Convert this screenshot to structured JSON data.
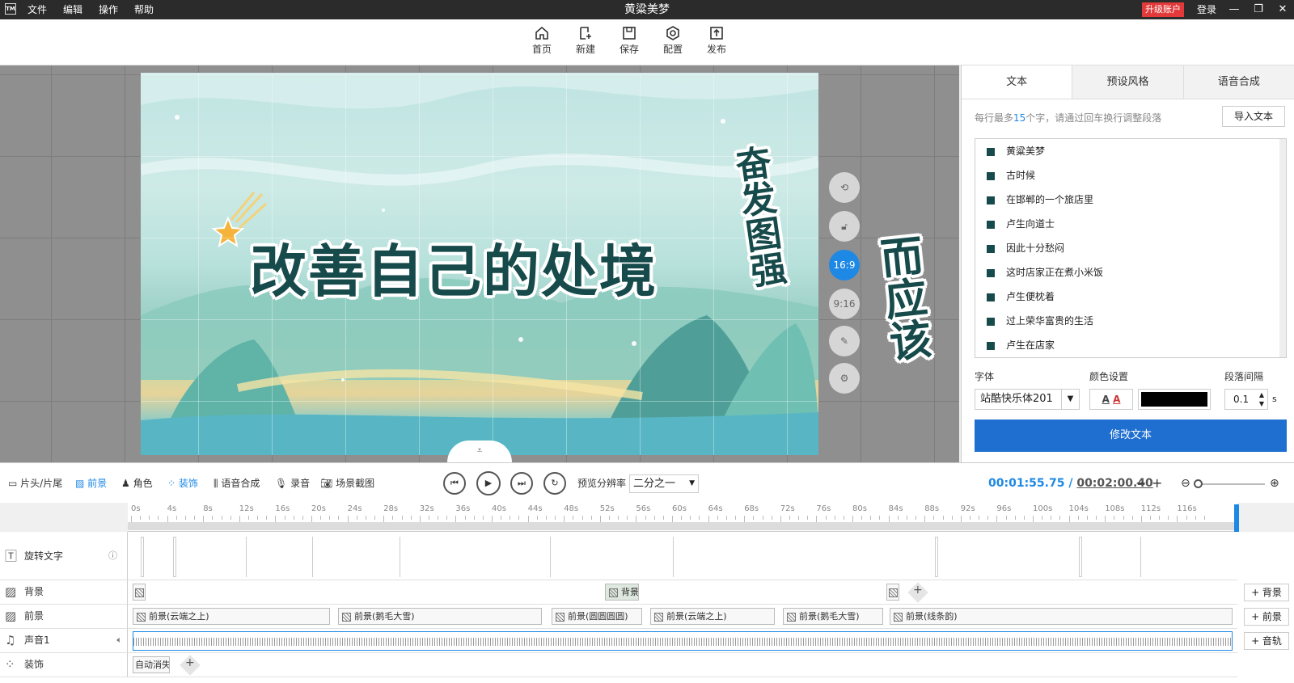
{
  "window": {
    "logo": "TM",
    "menu": [
      "文件",
      "编辑",
      "操作",
      "帮助"
    ],
    "title": "黄粱美梦",
    "upgrade_label": "升级账户",
    "login_label": "登录",
    "controls": [
      "—",
      "❐",
      "✕"
    ]
  },
  "toolbar": {
    "buttons": [
      {
        "label": "首页",
        "icon": "home-icon"
      },
      {
        "label": "新建",
        "icon": "new-icon"
      },
      {
        "label": "保存",
        "icon": "save-icon"
      },
      {
        "label": "配置",
        "icon": "settings-icon"
      },
      {
        "label": "发布",
        "icon": "publish-icon"
      }
    ]
  },
  "stage": {
    "main_text": "改善自己的处境",
    "side_text": "奋发图强",
    "outside_text": "而应该"
  },
  "canvas_controls": {
    "ratio_16_9": "16:9",
    "ratio_9_16": "9:16"
  },
  "panel": {
    "tabs": [
      "文本",
      "预设风格",
      "语音合成"
    ],
    "hint_before": "每行最多",
    "hint_num": "15",
    "hint_after": "个字，请通过回车换行调整段落",
    "import_label": "导入文本",
    "lines": [
      "黄粱美梦",
      "古时候",
      "在邯郸的一个旅店里",
      "卢生向道士",
      "因此十分愁闷",
      "这时店家正在煮小米饭",
      "卢生便枕着",
      "过上荣华富贵的生活",
      "卢生在店家"
    ],
    "font_label": "字体",
    "font_value": "站酷快乐体201",
    "color_label": "颜色设置",
    "spacing_label": "段落间隔",
    "spacing_value": "0.1",
    "spacing_unit": "s",
    "modify_label": "修改文本",
    "text_color": "#000000"
  },
  "timeline_bar": {
    "items": [
      "片头/片尾",
      "前景",
      "角色",
      "装饰",
      "语音合成",
      "录音",
      "场景截图"
    ],
    "preview_label": "预览分辨率",
    "preview_value": "二分之一",
    "current_time": "00:01:55.75",
    "separator": "/",
    "total_time": "00:02:00.40"
  },
  "ruler": {
    "ticks": [
      "0s",
      "4s",
      "8s",
      "12s",
      "16s",
      "20s",
      "24s",
      "28s",
      "32s",
      "36s",
      "40s",
      "44s",
      "48s",
      "52s",
      "56s",
      "60s",
      "64s",
      "68s",
      "72s",
      "76s",
      "80s",
      "84s",
      "88s",
      "92s",
      "96s",
      "100s",
      "104s",
      "108s",
      "112s",
      "116s"
    ]
  },
  "tracks": {
    "rotate_text": "旋转文字",
    "background": "背景",
    "foreground": "前景",
    "audio": "声音1",
    "decoration": "装饰",
    "bg_clip_label": "背景",
    "fg_clips": [
      "前景(云端之上)",
      "前景(鹅毛大雪)",
      "前景(圆圆圆圆)",
      "前景(云端之上)",
      "前景(鹅毛大雪)",
      "前景(线条韵)"
    ],
    "deco_clip": "自动消失",
    "add_bg": "+ 背景",
    "add_fg": "+ 前景",
    "add_audio": "+ 音轨"
  }
}
